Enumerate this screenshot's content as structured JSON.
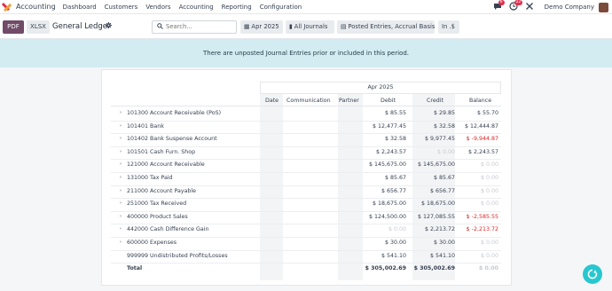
{
  "navbar": {
    "app_name": "Accounting",
    "items": [
      "Dashboard",
      "Customers",
      "Vendors",
      "Accounting",
      "Reporting",
      "Configuration"
    ],
    "messages_count": "6",
    "activity_count": "22",
    "company": "Demo Company"
  },
  "control": {
    "pdf_label": "PDF",
    "xlsx_label": "XLSX",
    "title": "General Ledger",
    "search_placeholder": "Search...",
    "filters": [
      {
        "icon": "calendar-icon",
        "label": "Apr 2025"
      },
      {
        "icon": "book-icon",
        "label": "All Journals"
      },
      {
        "icon": "filter-icon",
        "label": "Posted Entries, Accrual Basis"
      },
      {
        "icon": "",
        "label": "In .$"
      }
    ]
  },
  "banner": {
    "text": "There are unposted Journal Entries prior or included in this period."
  },
  "report": {
    "period": "Apr 2025",
    "columns": [
      "Date",
      "Communication",
      "Partner",
      "Debit",
      "Credit",
      "Balance"
    ],
    "rows": [
      {
        "name": "101300 Account Receivable (PoS)",
        "debit": "$ 85.55",
        "credit": "$ 29.85",
        "balance": "$ 55.70",
        "expandable": true
      },
      {
        "name": "101401 Bank",
        "debit": "$ 12,477.45",
        "credit": "$ 32.58",
        "balance": "$ 12,444.87",
        "expandable": true
      },
      {
        "name": "101402 Bank Suspense Account",
        "debit": "$ 32.58",
        "credit": "$ 9,977.45",
        "balance": "$ -9,944.87",
        "expandable": true
      },
      {
        "name": "101501 Cash Furn. Shop",
        "debit": "$ 2,243.57",
        "credit": "$ 0.00",
        "balance": "$ 2,243.57",
        "expandable": true
      },
      {
        "name": "121000 Account Receivable",
        "debit": "$ 145,675.00",
        "credit": "$ 145,675.00",
        "balance": "$ 0.00",
        "expandable": true
      },
      {
        "name": "131000 Tax Paid",
        "debit": "$ 85.67",
        "credit": "$ 85.67",
        "balance": "$ 0.00",
        "expandable": true
      },
      {
        "name": "211000 Account Payable",
        "debit": "$ 656.77",
        "credit": "$ 656.77",
        "balance": "$ 0.00",
        "expandable": true
      },
      {
        "name": "251000 Tax Received",
        "debit": "$ 18,675.00",
        "credit": "$ 18,675.00",
        "balance": "$ 0.00",
        "expandable": true
      },
      {
        "name": "400000 Product Sales",
        "debit": "$ 124,500.00",
        "credit": "$ 127,085.55",
        "balance": "$ -2,585.55",
        "expandable": true
      },
      {
        "name": "442000 Cash Difference Gain",
        "debit": "$ 0.00",
        "credit": "$ 2,213.72",
        "balance": "$ -2,213.72",
        "expandable": true
      },
      {
        "name": "600000 Expenses",
        "debit": "$ 30.00",
        "credit": "$ 30.00",
        "balance": "$ 0.00",
        "expandable": true
      },
      {
        "name": "999999 Undistributed Profits/Losses",
        "debit": "$ 541.10",
        "credit": "$ 541.10",
        "balance": "$ 0.00",
        "expandable": false
      },
      {
        "name": "Total",
        "debit": "$ 305,002.69",
        "credit": "$ 305,002.69",
        "balance": "$ 0.00",
        "expandable": false
      }
    ]
  },
  "colors": {
    "brand": "#714b67",
    "banner_bg": "#d3ecf1",
    "negative": "#dc2626",
    "help_bubble": "#28c7cf"
  }
}
